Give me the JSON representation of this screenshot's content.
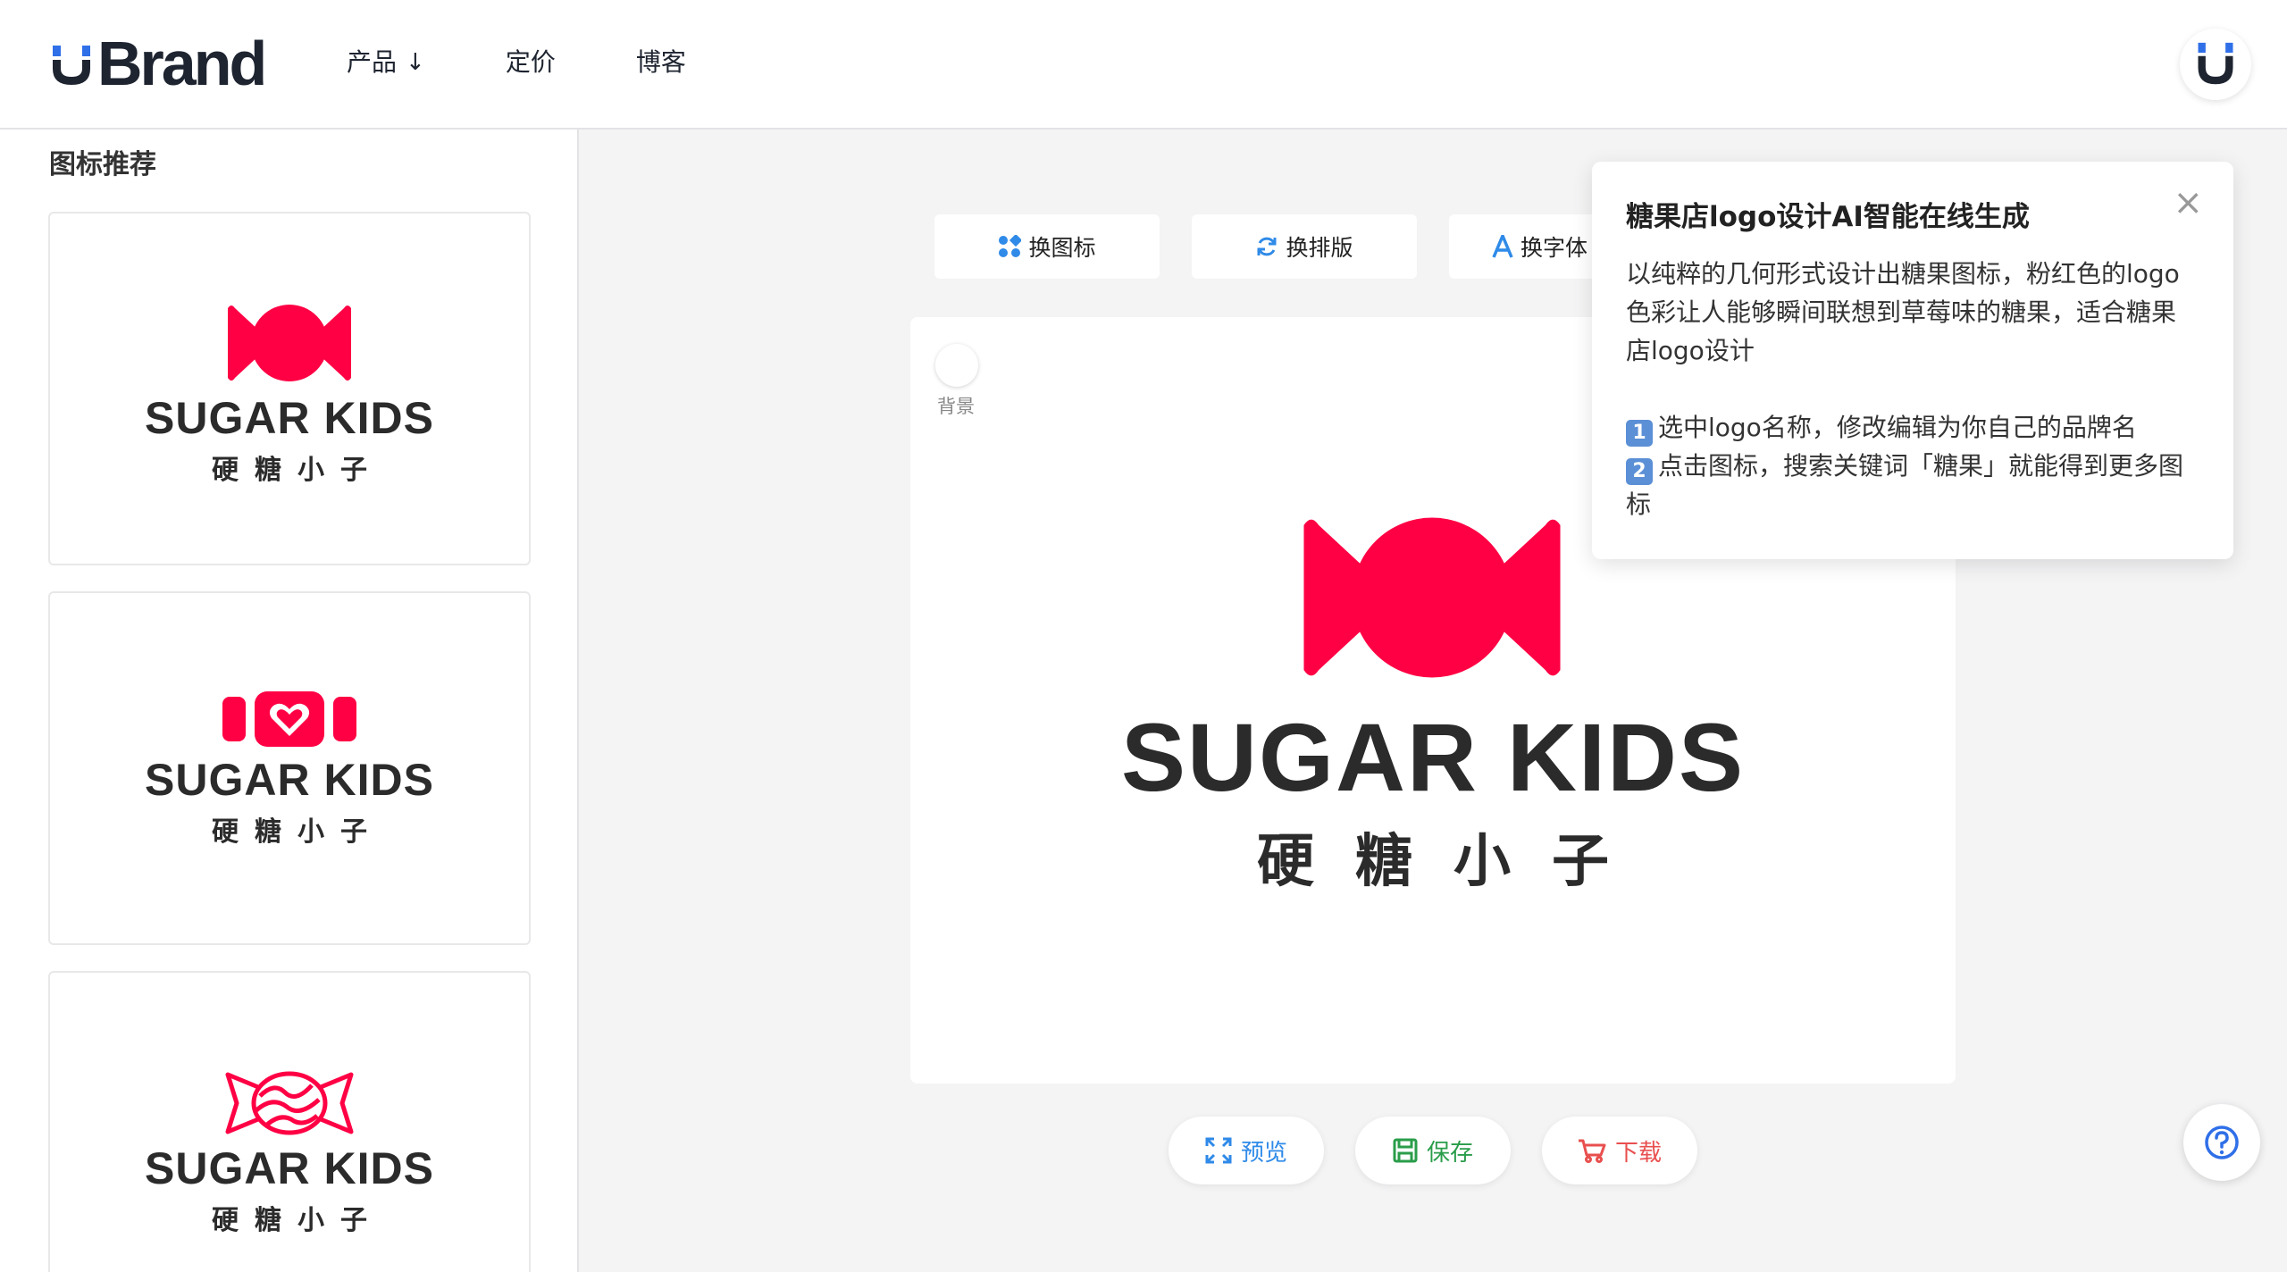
{
  "header": {
    "brand": "Brand",
    "nav": [
      {
        "label": "产品",
        "has_arrow": true
      },
      {
        "label": "定价"
      },
      {
        "label": "博客"
      }
    ],
    "arrow_glyph": "↓"
  },
  "sidebar": {
    "title": "图标推荐",
    "cards": [
      {
        "icon": "candy-bowtie-icon",
        "name": "SUGAR KIDS",
        "sub": "硬糖小子"
      },
      {
        "icon": "candy-heart-icon",
        "name": "SUGAR KIDS",
        "sub": "硬糖小子"
      },
      {
        "icon": "candy-wrapped-icon",
        "name": "SUGAR KIDS",
        "sub": "硬糖小子"
      }
    ]
  },
  "toolbar": {
    "change_icon": "换图标",
    "change_layout": "换排版",
    "change_font": "换字体"
  },
  "canvas": {
    "bg_label": "背景",
    "name": "SUGAR KIDS",
    "sub": "硬糖小子"
  },
  "actions": {
    "preview": "预览",
    "save": "保存",
    "download": "下载"
  },
  "tooltip": {
    "title": "糖果店logo设计AI智能在线生成",
    "desc": "以纯粹的几何形式设计出糖果图标，粉红色的logo色彩让人能够瞬间联想到草莓味的糖果，适合糖果店logo设计",
    "step1_num": "1",
    "step1": "选中logo名称，修改编辑为你自己的品牌名",
    "step2_num": "2",
    "step2": "点击图标，搜索关键词「糖果」就能得到更多图标",
    "close": "×"
  },
  "colors": {
    "brand_blue": "#2f6fe8",
    "logo_pink": "#ff0044",
    "text_dark": "#2b2b2b",
    "save_green": "#2a9d4a",
    "download_red": "#e8504f",
    "preview_blue": "#2f8ae8"
  }
}
